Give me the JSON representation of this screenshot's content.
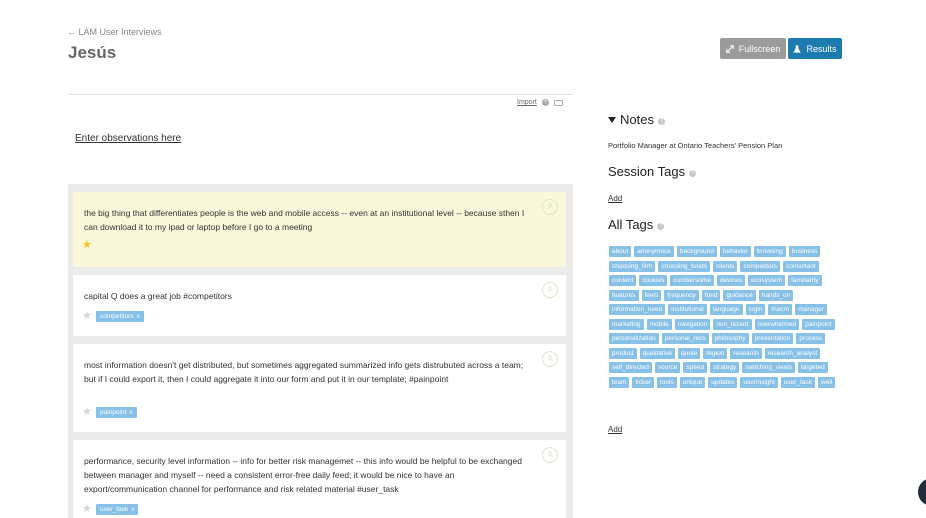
{
  "header": {
    "breadcrumb": "← LAM User Interviews",
    "title": "Jesús",
    "fullscreen_label": "Fullscreen",
    "results_label": "Results"
  },
  "observations": {
    "import_label": "Import",
    "enter_label": "Enter observations here",
    "cards": [
      {
        "text": "the big thing that differentiates people is the web and mobile access -- even at an institutional level -- because sthen I can download it to my ipad or laptop before I go to a meeting",
        "count": "0",
        "starred": true,
        "tags": []
      },
      {
        "text": "capital Q does a great job #competitors",
        "count": "0",
        "starred": false,
        "tags": [
          "competitors"
        ]
      },
      {
        "text": "most information doesn't get distributed, but sometimes aggregated summarized info gets distrubuted across a team; but if I could export it, then I could aggregate it into our form and put it in our template; #painpoint",
        "count": "0",
        "starred": false,
        "tags": [
          "painpoint"
        ]
      },
      {
        "text": "performance, security level information -- info for better risk managemet -- this info would be helpful to be exchanged between manager and myself -- need a consistent error-free daily feed; it would be nice to have an export/communication channel for performance and risk related material #user_task",
        "count": "0",
        "starred": false,
        "tags": [
          "user_task"
        ]
      }
    ],
    "tag_remove_symbol": "x"
  },
  "notes": {
    "heading": "Notes",
    "text": "Portfolio Manager at Ontario Teachers' Pension Plan"
  },
  "session_tags": {
    "heading": "Session Tags",
    "add_label": "Add"
  },
  "all_tags": {
    "heading": "All Tags",
    "add_label": "Add",
    "tags": [
      "about",
      "anonymous",
      "background",
      "behavior",
      "browsing",
      "business",
      "choosing_firm",
      "choosing_funds",
      "clients",
      "competitors",
      "consultant",
      "content",
      "cookies",
      "cumbersome",
      "devices",
      "ecosystem",
      "familiarity",
      "features",
      "feels",
      "frequency",
      "fund",
      "guidance",
      "hands_on",
      "information_need",
      "institutional",
      "language",
      "login",
      "macro",
      "manager",
      "marketing",
      "mobile",
      "navigation",
      "non_lazard",
      "overwhelmed",
      "painpoint",
      "personalization",
      "personal_recs",
      "philosophy",
      "presentation",
      "process",
      "product",
      "qualitative",
      "quote",
      "region",
      "research",
      "research_analyst",
      "self_directed",
      "source",
      "speed",
      "strategy",
      "switching_views",
      "targeted",
      "team",
      "ticker",
      "tools",
      "unique",
      "updates",
      "userinsight",
      "user_task",
      "well"
    ]
  },
  "colors": {
    "accent": "#1d7bb0",
    "tag": "#88c1e7",
    "highlight_card": "#faf8d8",
    "star": "#f1c21b"
  }
}
